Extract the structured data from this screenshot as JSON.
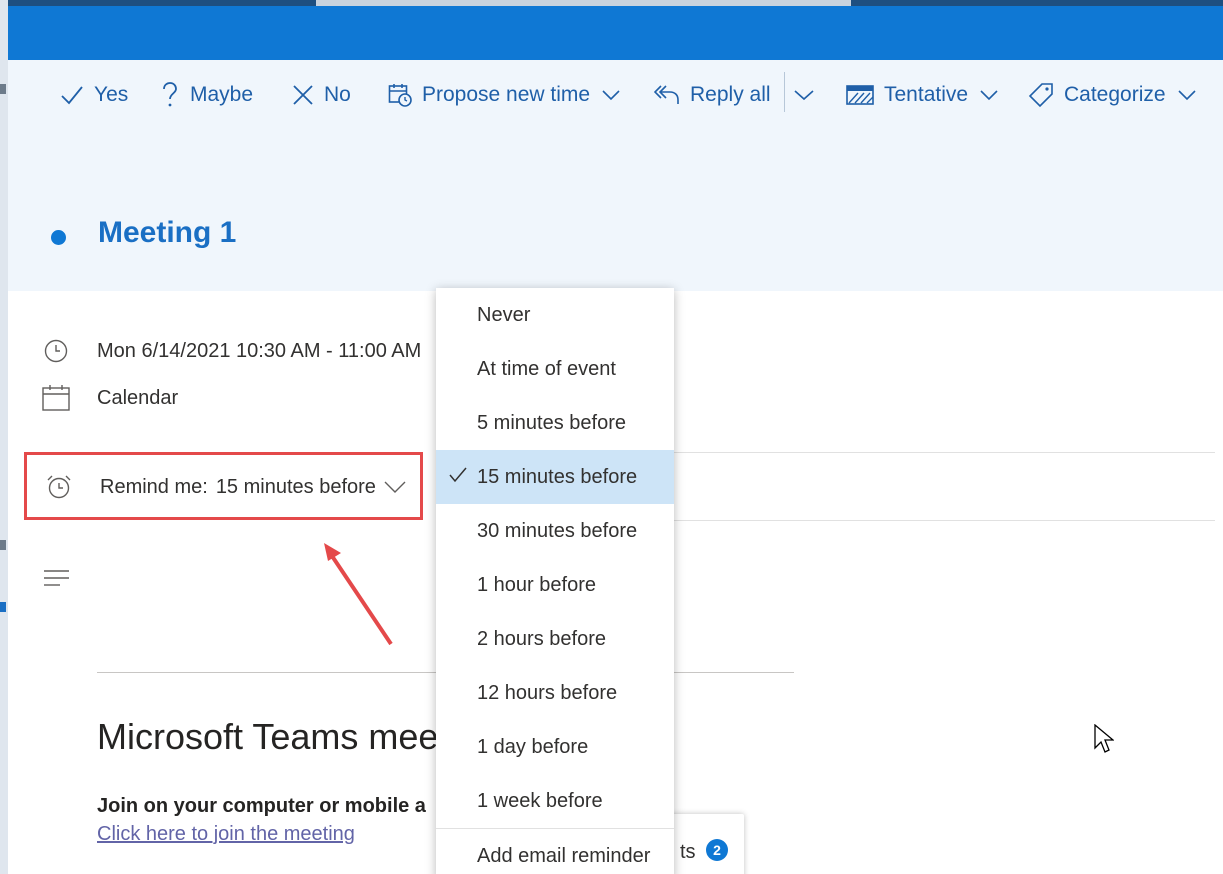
{
  "toolbar": {
    "yes": "Yes",
    "maybe": "Maybe",
    "no": "No",
    "propose_new_time": "Propose new time",
    "reply_all": "Reply all",
    "tentative": "Tentative",
    "categorize": "Categorize"
  },
  "event": {
    "title": "Meeting 1",
    "datetime": "Mon 6/14/2021 10:30 AM - 11:00 AM",
    "calendar": "Calendar"
  },
  "reminder": {
    "label": "Remind me:",
    "value": "15 minutes before"
  },
  "dropdown": {
    "options": [
      "Never",
      "At time of event",
      "5 minutes before",
      "15 minutes before",
      "30 minutes before",
      "1 hour before",
      "2 hours before",
      "12 hours before",
      "1 day before",
      "1 week before"
    ],
    "selected": "15 minutes before",
    "add_email_reminder": "Add email reminder"
  },
  "body": {
    "teams_title": "Microsoft Teams meet",
    "join_text": "Join on your computer or mobile a",
    "join_link": "Click here to join the meeting"
  },
  "chip": {
    "text": "ts",
    "count": "2"
  },
  "colors": {
    "accent": "#0f78d4",
    "highlight_box": "#e4494a",
    "selected_bg": "#cde4f7",
    "link": "#6264a7"
  },
  "icons": {
    "yes": "check-icon",
    "maybe": "question-icon",
    "no": "close-icon",
    "propose": "calendar-clock-icon",
    "reply_all": "reply-all-icon",
    "tentative": "tentative-status-icon",
    "categorize": "tag-icon",
    "time": "clock-icon",
    "calendar": "calendar-icon",
    "reminder": "alarm-clock-icon",
    "notes": "notes-lines-icon"
  }
}
